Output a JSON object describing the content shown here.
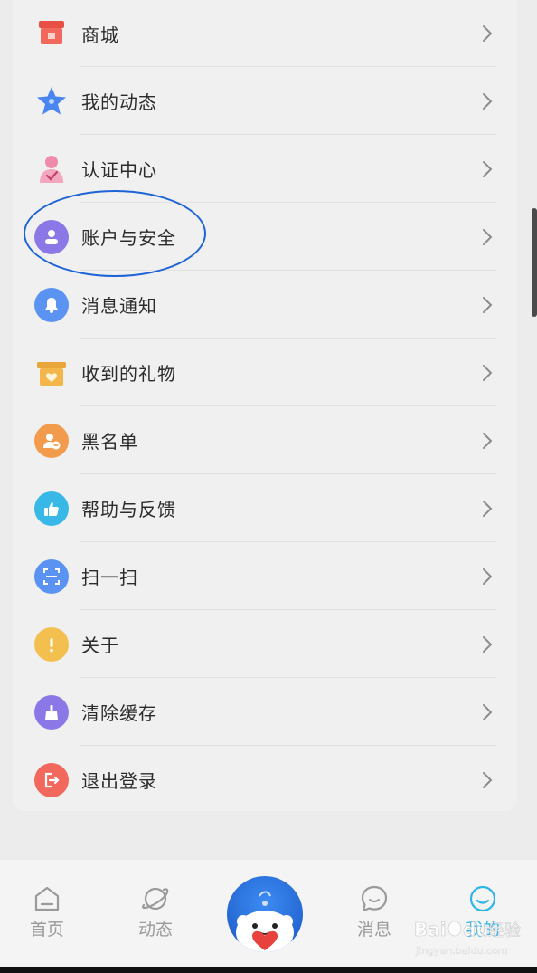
{
  "menu": {
    "items": [
      {
        "label": "商城",
        "icon": "store-icon",
        "color": "#f2685c"
      },
      {
        "label": "我的动态",
        "icon": "star-icon",
        "color": "#4a86f0"
      },
      {
        "label": "认证中心",
        "icon": "certified-user-icon",
        "color": "#f08cab"
      },
      {
        "label": "账户与安全",
        "icon": "account-icon",
        "color": "#8b78e6"
      },
      {
        "label": "消息通知",
        "icon": "bell-icon",
        "color": "#5a93f2"
      },
      {
        "label": "收到的礼物",
        "icon": "gift-box-icon",
        "color": "#f3b64a"
      },
      {
        "label": "黑名单",
        "icon": "blacklist-user-icon",
        "color": "#f39b4c"
      },
      {
        "label": "帮助与反馈",
        "icon": "thumbs-up-icon",
        "color": "#37b8e6"
      },
      {
        "label": "扫一扫",
        "icon": "scan-icon",
        "color": "#5a93f2"
      },
      {
        "label": "关于",
        "icon": "exclamation-icon",
        "color": "#f3c04f"
      },
      {
        "label": "清除缓存",
        "icon": "broom-icon",
        "color": "#8b78e6"
      },
      {
        "label": "退出登录",
        "icon": "logout-icon",
        "color": "#f2685c"
      }
    ]
  },
  "tabbar": {
    "tabs": [
      {
        "label": "首页",
        "icon": "home-icon"
      },
      {
        "label": "动态",
        "icon": "planet-icon"
      },
      {
        "label": "消息",
        "icon": "chat-bubble-icon"
      },
      {
        "label": "我的",
        "icon": "smile-icon",
        "active": true
      }
    ],
    "accent": "#2fb4e8"
  },
  "highlight_color": "#1e64d6",
  "watermark": {
    "text": "Baidu经验",
    "sub": "jingyan.baidu.com"
  }
}
